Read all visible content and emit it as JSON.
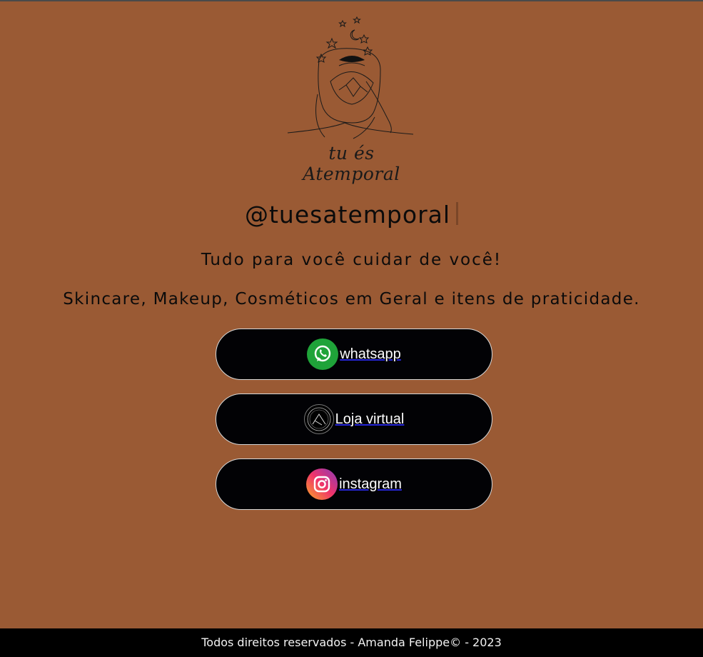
{
  "logo": {
    "text": "tu és Atemporal"
  },
  "profile": {
    "handle": "@tuesatemporal"
  },
  "tagline": "Tudo para você cuidar de você!",
  "description": "Skincare, Makeup, Cosméticos em Geral e itens de praticidade.",
  "links": [
    {
      "label": "whatsapp",
      "icon": "whatsapp-icon"
    },
    {
      "label": "Loja virtual",
      "icon": "store-logo-icon"
    },
    {
      "label": "instagram",
      "icon": "instagram-icon"
    }
  ],
  "footer": {
    "text": "Todos direitos reservados - Amanda Felippe© - 2023"
  },
  "colors": {
    "background": "#9a5a34",
    "button": "#020205",
    "footer": "#000000"
  }
}
